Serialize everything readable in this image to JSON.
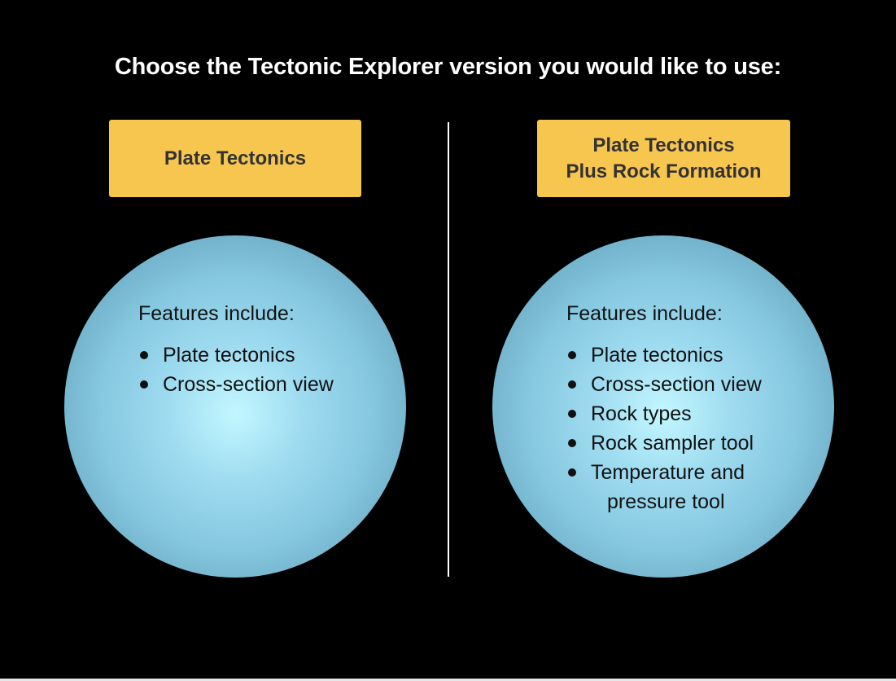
{
  "heading": "Choose the Tectonic Explorer version you would like to use:",
  "versions": [
    {
      "button_lines": [
        "Plate Tectonics"
      ],
      "features_title": "Features include:",
      "features": [
        "Plate tectonics",
        "Cross-section view"
      ]
    },
    {
      "button_lines": [
        "Plate Tectonics",
        "Plus Rock Formation"
      ],
      "features_title": "Features include:",
      "features": [
        "Plate tectonics",
        "Cross-section view",
        "Rock types",
        "Rock sampler tool",
        "Temperature and"
      ],
      "features_wrap": "pressure tool"
    }
  ],
  "colors": {
    "background": "#000000",
    "button": "#f7c64f",
    "button_text": "#333333",
    "heading_text": "#ffffff",
    "sphere_highlight": "#c3f7ff",
    "sphere_edge": "#3f7289"
  }
}
